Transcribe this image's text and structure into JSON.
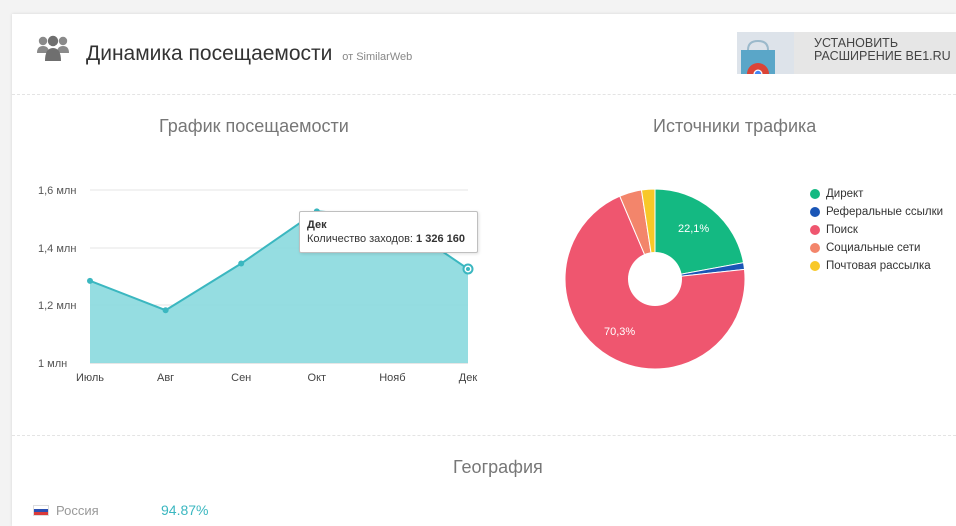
{
  "header": {
    "title": "Динамика посещаемости",
    "source": "от SimilarWeb",
    "install_button": "УСТАНОВИТЬ\nРАСШИРЕНИЕ BE1.RU"
  },
  "visits_chart": {
    "heading": "График посещаемости",
    "y_ticks": [
      "1,6 млн",
      "1,4 млн",
      "1,2 млн",
      "1 млн"
    ],
    "tooltip": {
      "month": "Дек",
      "label": "Количество заходов:",
      "value": "1 326 160"
    }
  },
  "traffic_chart": {
    "heading": "Источники трафика",
    "label_direct": "22,1%",
    "label_search": "70,3%"
  },
  "geography": {
    "heading": "География",
    "rows": [
      {
        "country": "Россия",
        "percent": "94.87%"
      }
    ]
  },
  "colors": {
    "area_fill": "#8fdbdf",
    "area_line": "#3bb7c0",
    "direct": "#14b982",
    "referral": "#1a56b6",
    "search": "#ef566f",
    "social": "#f3856b",
    "mail": "#f8c828"
  },
  "chart_data": [
    {
      "type": "area",
      "title": "График посещаемости",
      "categories": [
        "Июль",
        "Авг",
        "Сен",
        "Окт",
        "Нояб",
        "Дек"
      ],
      "values": [
        1285000,
        1183000,
        1345000,
        1526000,
        1505000,
        1326160
      ],
      "ylim": [
        1000000,
        1600000
      ],
      "y_tick_values": [
        1000000,
        1200000,
        1400000,
        1600000
      ],
      "grid": true
    },
    {
      "type": "pie",
      "title": "Источники трафика",
      "legend_position": "right",
      "series": [
        {
          "name": "Директ",
          "value": 22.1
        },
        {
          "name": "Реферальные ссылки",
          "value": 1.2
        },
        {
          "name": "Поиск",
          "value": 70.3
        },
        {
          "name": "Социальные сети",
          "value": 4.0
        },
        {
          "name": "Почтовая рассылка",
          "value": 2.4
        }
      ]
    }
  ]
}
